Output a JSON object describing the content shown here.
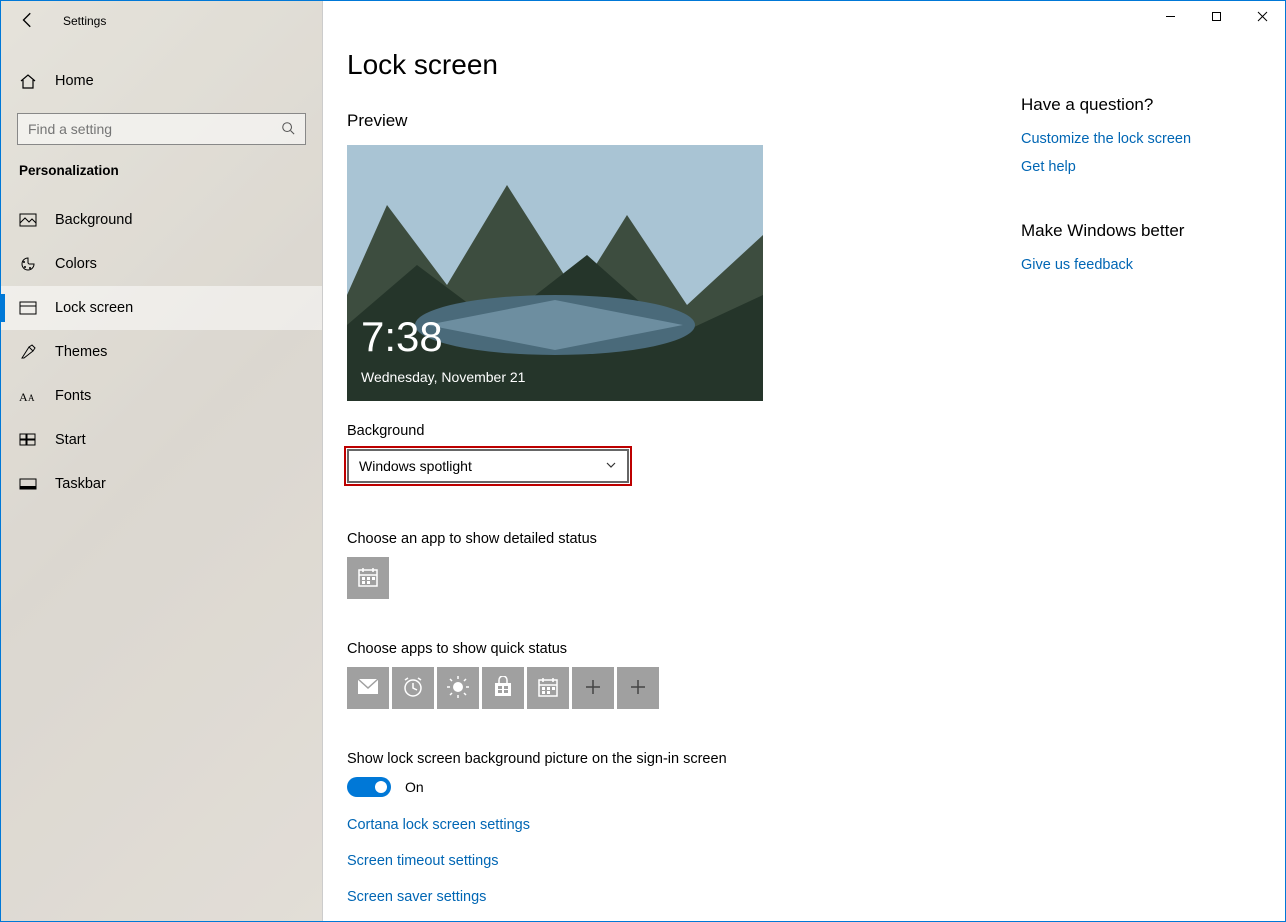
{
  "window": {
    "title": "Settings"
  },
  "sidebar": {
    "home": "Home",
    "search_placeholder": "Find a setting",
    "section": "Personalization",
    "items": [
      {
        "label": "Background",
        "icon": "background-icon",
        "selected": false
      },
      {
        "label": "Colors",
        "icon": "colors-icon",
        "selected": false
      },
      {
        "label": "Lock screen",
        "icon": "lock-screen-icon",
        "selected": true
      },
      {
        "label": "Themes",
        "icon": "themes-icon",
        "selected": false
      },
      {
        "label": "Fonts",
        "icon": "fonts-icon",
        "selected": false
      },
      {
        "label": "Start",
        "icon": "start-icon",
        "selected": false
      },
      {
        "label": "Taskbar",
        "icon": "taskbar-icon",
        "selected": false
      }
    ]
  },
  "main": {
    "title": "Lock screen",
    "preview_label": "Preview",
    "preview_time": "7:38",
    "preview_date": "Wednesday, November 21",
    "background_label": "Background",
    "background_value": "Windows spotlight",
    "detailed_label": "Choose an app to show detailed status",
    "quick_label": "Choose apps to show quick status",
    "signin_bg_label": "Show lock screen background picture on the sign-in screen",
    "toggle_state": "On",
    "links": {
      "cortana": "Cortana lock screen settings",
      "timeout": "Screen timeout settings",
      "saver": "Screen saver settings"
    }
  },
  "right": {
    "q_head": "Have a question?",
    "q_link1": "Customize the lock screen",
    "q_link2": "Get help",
    "fb_head": "Make Windows better",
    "fb_link": "Give us feedback"
  }
}
